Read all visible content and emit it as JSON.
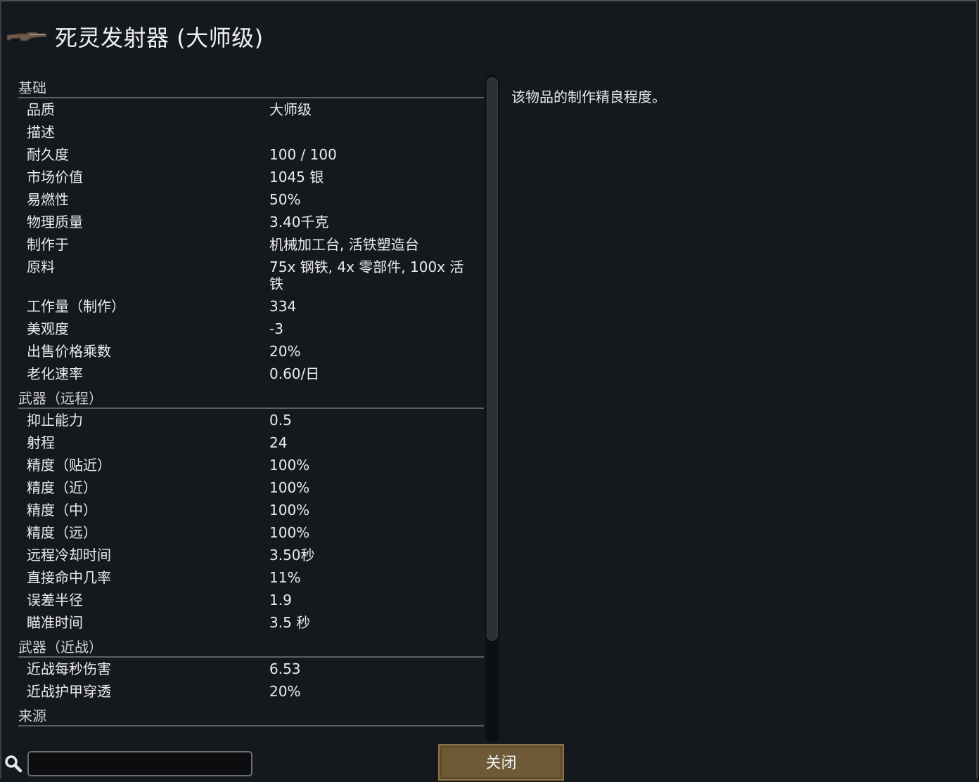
{
  "window": {
    "title": "死灵发射器 (大师级)",
    "icon": "gun-icon"
  },
  "description": "该物品的制作精良程度。",
  "sections": [
    {
      "header": "基础",
      "rows": [
        {
          "label": "品质",
          "value": "大师级"
        },
        {
          "label": "描述",
          "value": ""
        },
        {
          "label": "耐久度",
          "value": "100 / 100"
        },
        {
          "label": "市场价值",
          "value": "1045 银"
        },
        {
          "label": "易燃性",
          "value": "50%"
        },
        {
          "label": "物理质量",
          "value": "3.40千克"
        },
        {
          "label": "制作于",
          "value": "机械加工台, 活铁塑造台"
        },
        {
          "label": "原料",
          "value": "75x 钢铁, 4x 零部件, 100x 活铁"
        },
        {
          "label": "工作量（制作）",
          "value": "334"
        },
        {
          "label": "美观度",
          "value": "-3"
        },
        {
          "label": "出售价格乘数",
          "value": "20%"
        },
        {
          "label": "老化速率",
          "value": "0.60/日"
        }
      ]
    },
    {
      "header": "武器（远程）",
      "rows": [
        {
          "label": "抑止能力",
          "value": "0.5"
        },
        {
          "label": "射程",
          "value": "24"
        },
        {
          "label": "精度（贴近）",
          "value": "100%"
        },
        {
          "label": "精度（近）",
          "value": "100%"
        },
        {
          "label": "精度（中）",
          "value": "100%"
        },
        {
          "label": "精度（远）",
          "value": "100%"
        },
        {
          "label": "远程冷却时间",
          "value": "3.50秒"
        },
        {
          "label": "直接命中几率",
          "value": "11%"
        },
        {
          "label": "误差半径",
          "value": "1.9"
        },
        {
          "label": "瞄准时间",
          "value": "3.5 秒"
        }
      ]
    },
    {
      "header": "武器（近战）",
      "rows": [
        {
          "label": "近战每秒伤害",
          "value": "6.53"
        },
        {
          "label": "近战护甲穿透",
          "value": "20%"
        }
      ]
    },
    {
      "header": "来源",
      "rows": []
    }
  ],
  "search": {
    "icon": "search-icon",
    "value": ""
  },
  "close_button": {
    "label": "关闭"
  },
  "colors": {
    "background": "#15191e",
    "button": "#6e5a36",
    "text": "#e2e2e2"
  }
}
